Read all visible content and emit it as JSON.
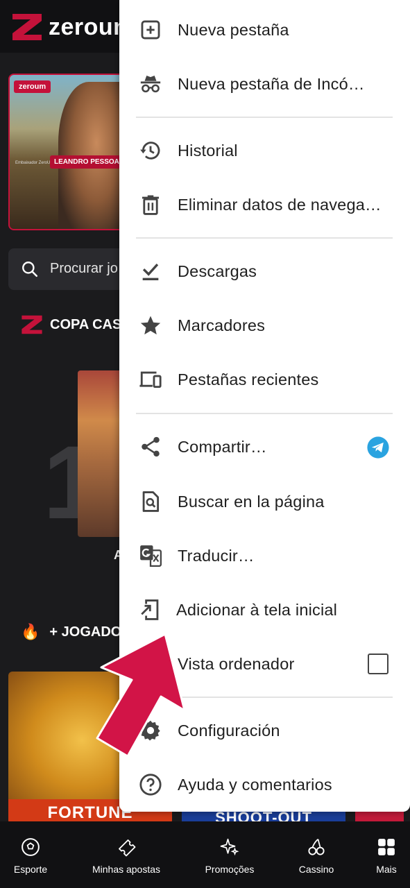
{
  "site": {
    "logo_text": "zeroum",
    "banner": {
      "brand": "zeroum",
      "ambassador": "Embaixador ZeroUm",
      "name": "LEANDRO PESSOA"
    },
    "search_placeholder": "Procurar jo",
    "section_copa": "COPA CAS",
    "rank_number": "1",
    "game_1_label": "A",
    "section_played": "+ JOGADOS",
    "game_2_title": "FORTUNE",
    "game_3_title": "SHOOT-OUT"
  },
  "bottom_nav": [
    {
      "label": "Esporte",
      "icon": "soccer-ball-icon"
    },
    {
      "label": "Minhas apostas",
      "icon": "ticket-icon"
    },
    {
      "label": "Promoções",
      "icon": "sparkles-icon"
    },
    {
      "label": "Cassino",
      "icon": "cherries-icon"
    },
    {
      "label": "Mais",
      "icon": "grid-icon"
    }
  ],
  "menu": {
    "items": [
      {
        "label": "Nueva pestaña",
        "icon": "new-tab-icon"
      },
      {
        "label": "Nueva pestaña de Incó…",
        "icon": "incognito-icon"
      },
      {
        "label": "Historial",
        "icon": "history-icon"
      },
      {
        "label": "Eliminar datos de navega…",
        "icon": "trash-icon"
      },
      {
        "label": "Descargas",
        "icon": "download-icon"
      },
      {
        "label": "Marcadores",
        "icon": "star-icon"
      },
      {
        "label": "Pestañas recientes",
        "icon": "devices-icon"
      },
      {
        "label": "Compartir…",
        "icon": "share-icon"
      },
      {
        "label": "Buscar en la página",
        "icon": "find-in-page-icon"
      },
      {
        "label": "Traducir…",
        "icon": "translate-icon"
      },
      {
        "label": "Adicionar à tela inicial",
        "icon": "add-to-home-icon"
      },
      {
        "label": "Vista ordenador",
        "icon": "desktop-icon"
      },
      {
        "label": "Configuración",
        "icon": "settings-icon"
      },
      {
        "label": "Ayuda y comentarios",
        "icon": "help-icon"
      }
    ],
    "desktop_view_checked": false
  },
  "colors": {
    "brand_red": "#c4123a",
    "menu_bg": "#ffffff",
    "telegram_blue": "#2aa3e0",
    "arrow": "#d21447"
  }
}
